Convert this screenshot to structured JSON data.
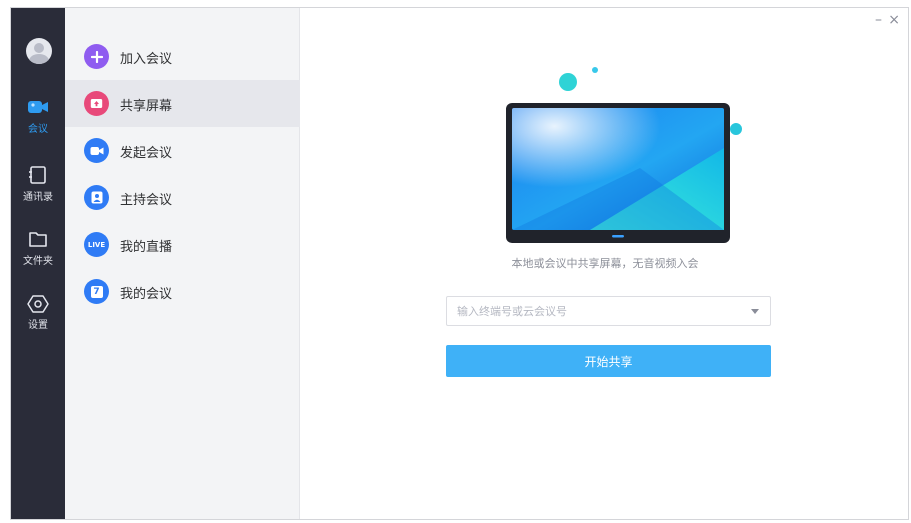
{
  "window": {
    "minimize_glyph": "–",
    "close_glyph": "×"
  },
  "rail": {
    "items": [
      {
        "label": "会议",
        "icon": "video-camera-icon",
        "active": true
      },
      {
        "label": "通讯录",
        "icon": "contacts-icon",
        "active": false
      },
      {
        "label": "文件夹",
        "icon": "folder-icon",
        "active": false
      },
      {
        "label": "设置",
        "icon": "settings-hexagon-icon",
        "active": false
      }
    ]
  },
  "menu": {
    "items": [
      {
        "label": "加入会议",
        "icon": "plus-icon",
        "color": "#8f5cf0",
        "active": false
      },
      {
        "label": "共享屏幕",
        "icon": "share-screen-icon",
        "color": "#e8497a",
        "active": true
      },
      {
        "label": "发起会议",
        "icon": "video-camera-icon",
        "color": "#2f7bf5",
        "active": false
      },
      {
        "label": "主持会议",
        "icon": "host-person-icon",
        "color": "#2f7bf5",
        "active": false
      },
      {
        "label": "我的直播",
        "icon": "live-icon",
        "badge_text": "LIVE",
        "color": "#2f7bf5",
        "active": false
      },
      {
        "label": "我的会议",
        "icon": "calendar-icon",
        "badge_text": "7",
        "color": "#2f7bf5",
        "active": false
      }
    ]
  },
  "main": {
    "hint": "本地或会议中共享屏幕，无音视频入会",
    "terminal_placeholder": "输入终端号或云会议号",
    "start_button": "开始共享"
  },
  "colors": {
    "rail_bg": "#2a2c39",
    "accent": "#3fb1f7",
    "menu_bg": "#f3f4f6"
  }
}
